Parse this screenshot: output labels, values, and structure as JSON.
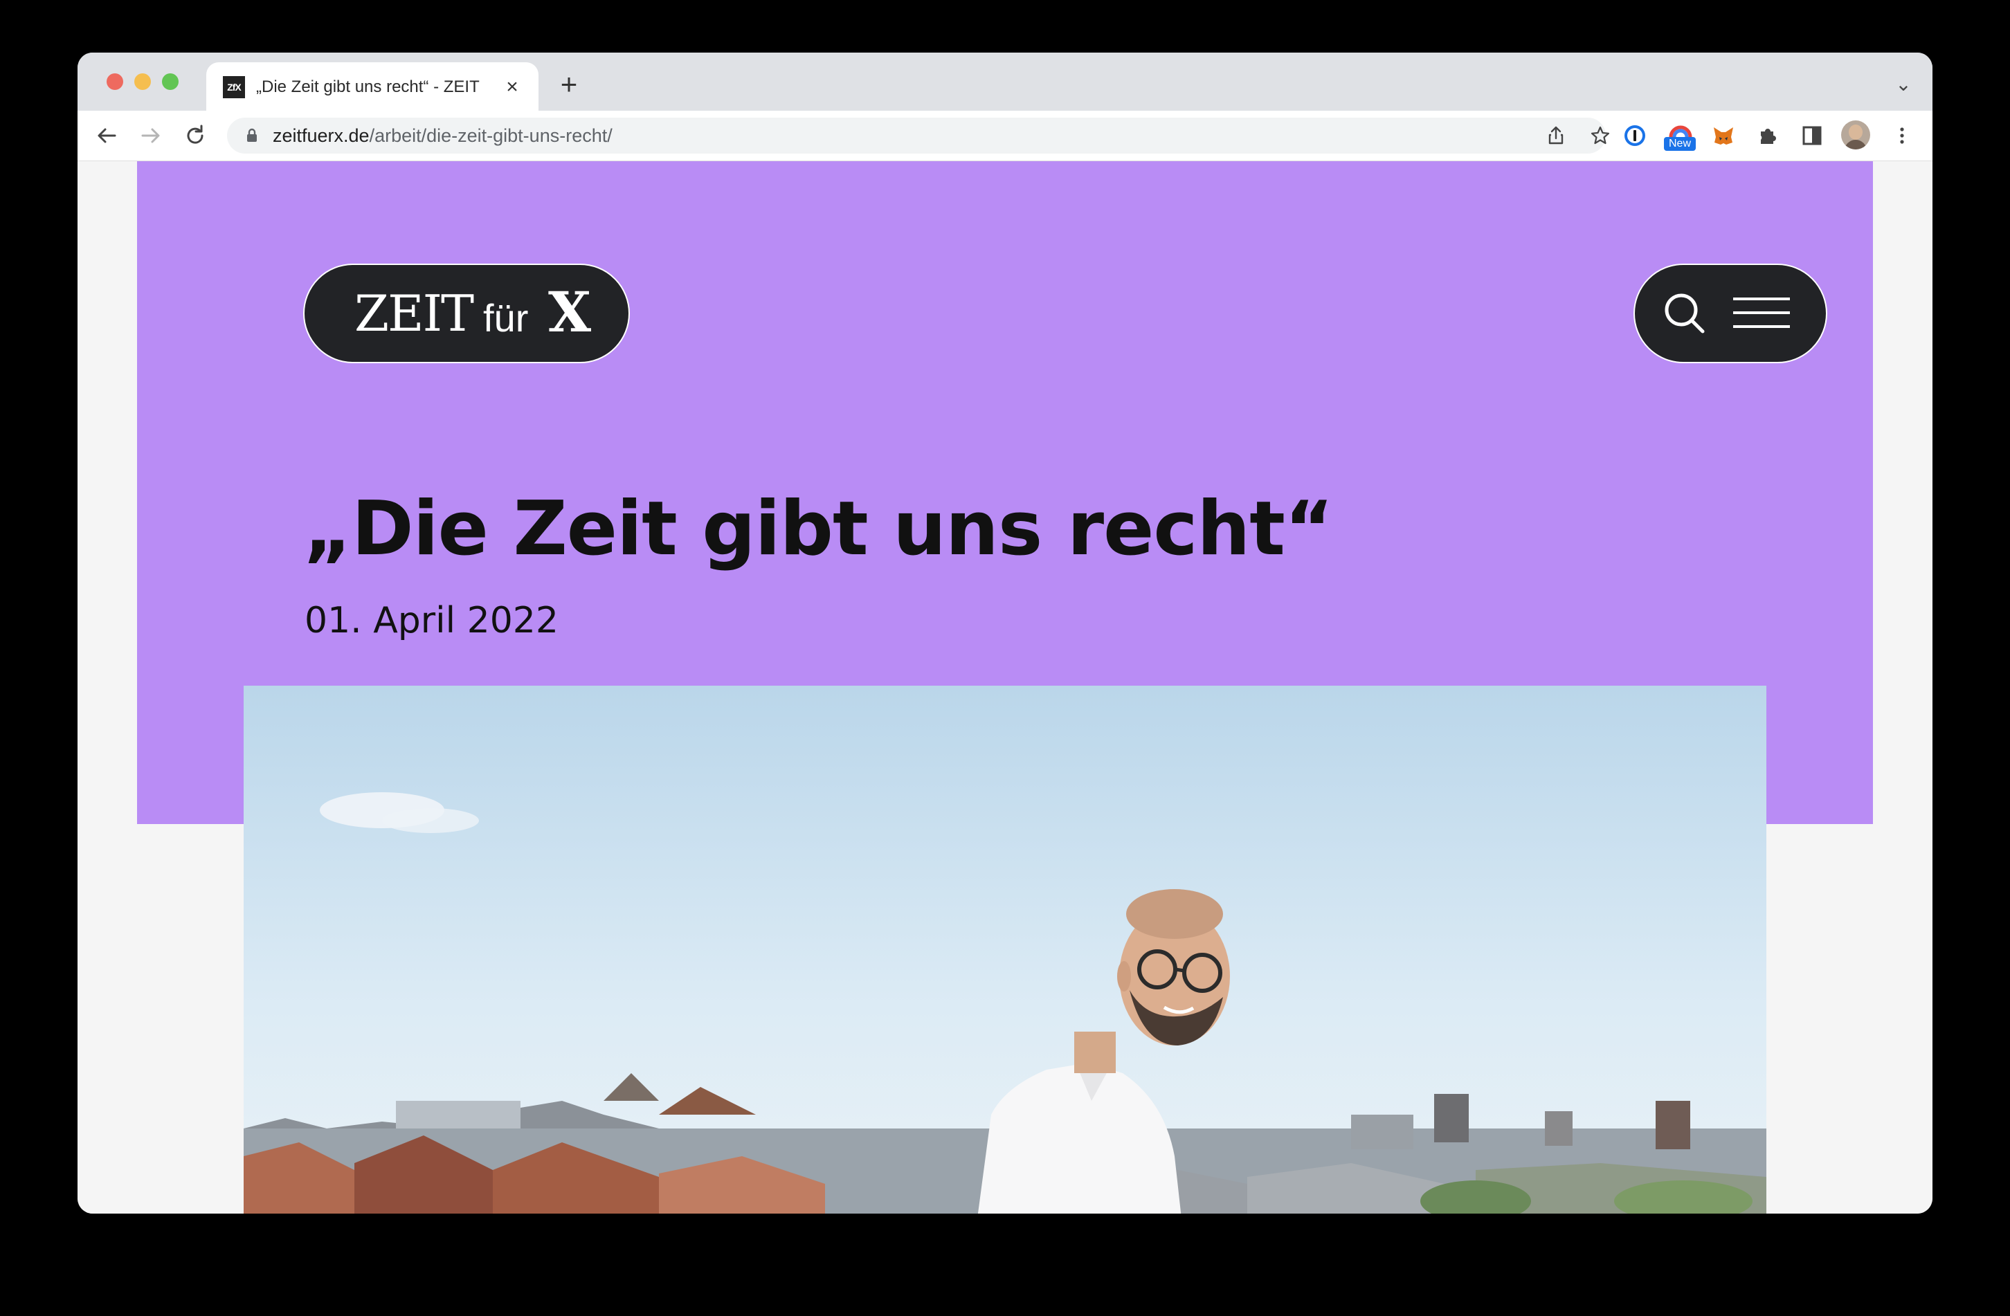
{
  "browser": {
    "tab": {
      "favicon_text": "ZfX",
      "title": "„Die Zeit gibt uns recht“ - ZEIT"
    },
    "url": {
      "domain": "zeitfuerx.de",
      "path": "/arbeit/die-zeit-gibt-uns-recht/"
    },
    "extensions": {
      "new_badge": "New"
    },
    "icons": {
      "back": "arrow-left-icon",
      "forward": "arrow-right-icon",
      "reload": "reload-icon",
      "lock": "lock-icon",
      "share": "share-icon",
      "bookmark": "star-icon",
      "password_manager": "1password-icon",
      "extensions": "puzzle-icon",
      "side_panel": "side-panel-icon",
      "menu": "kebab-menu-icon"
    }
  },
  "site": {
    "logo": {
      "zeit": "ZEIT",
      "fur": "für",
      "x": "X"
    },
    "article": {
      "headline": "„Die Zeit gibt uns recht“",
      "date": "01. April 2022"
    },
    "colors": {
      "hero_background": "#b98cf5",
      "pill_background": "#222326",
      "text": "#111111"
    }
  }
}
